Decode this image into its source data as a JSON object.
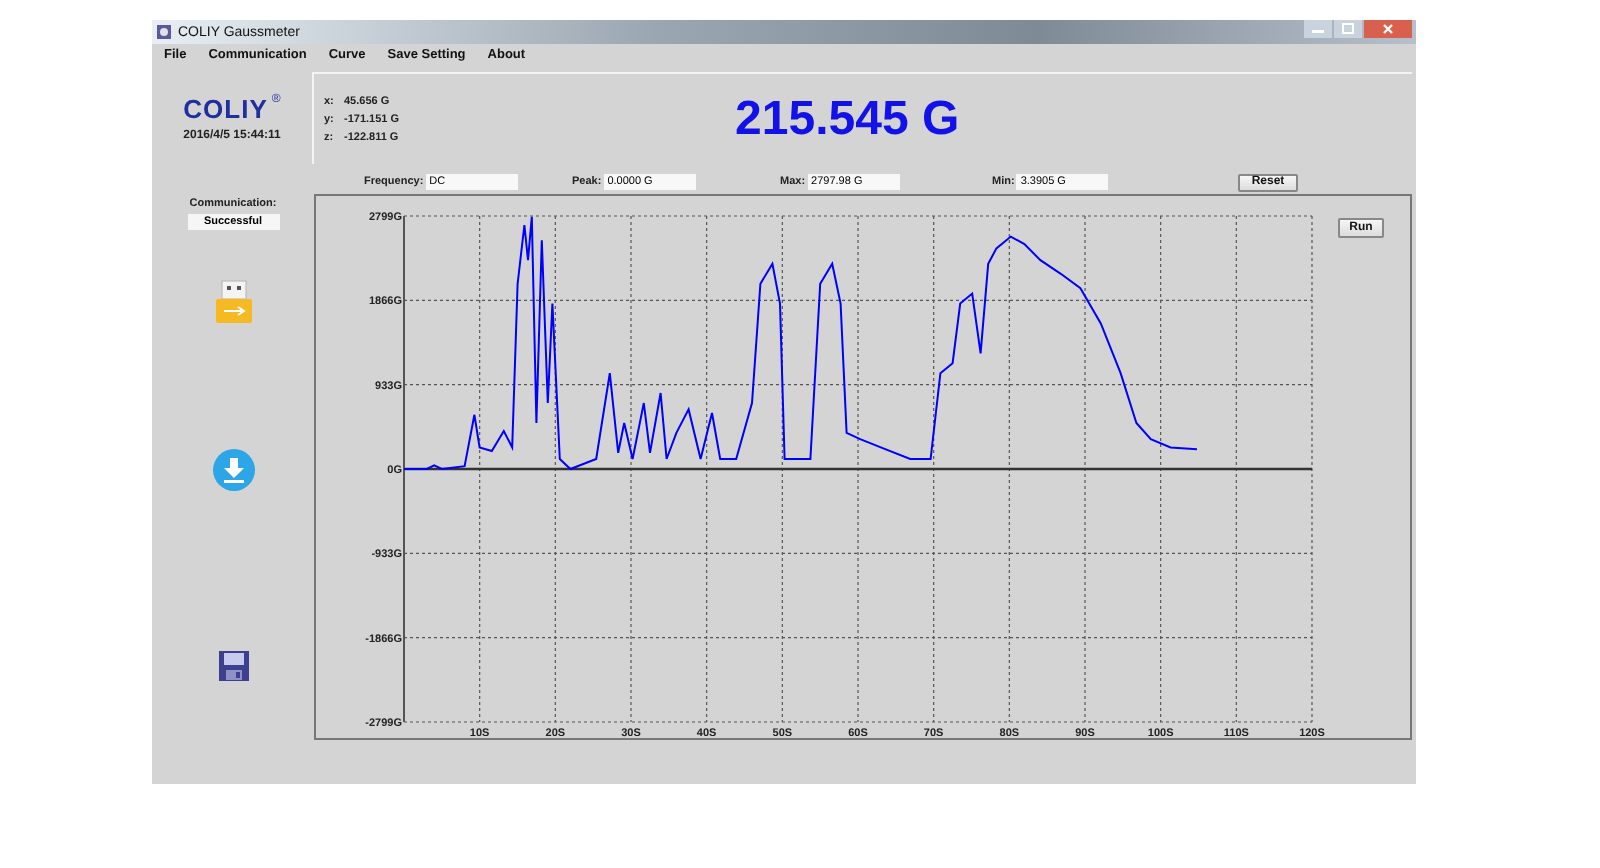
{
  "window": {
    "title": "COLIY Gaussmeter"
  },
  "menu": [
    "File",
    "Communication",
    "Curve",
    "Save Setting",
    "About"
  ],
  "logo": {
    "text": "COLIY",
    "mark": "®"
  },
  "datetime": "2016/4/5 15:44:11",
  "axes": [
    {
      "label": "x:",
      "value": "45.656 G"
    },
    {
      "label": "y:",
      "value": "-171.151 G"
    },
    {
      "label": "z:",
      "value": "-122.811 G"
    }
  ],
  "main_reading": "215.545 G",
  "stats": [
    {
      "label": "Frequency:",
      "value": "DC"
    },
    {
      "label": "Peak:",
      "value": "0.0000 G"
    },
    {
      "label": "Max:",
      "value": "2797.98 G"
    },
    {
      "label": "Min:",
      "value": "3.3905 G"
    }
  ],
  "reset_button": "Reset",
  "sidebar": {
    "communication_label": "Communication:",
    "status": "Successful"
  },
  "chart": {
    "run_button": "Run",
    "chart_data": {
      "type": "line",
      "grid": true,
      "xlim": [
        0,
        120
      ],
      "ylim": [
        -2799,
        2799
      ],
      "xticks": [
        {
          "value": 10,
          "label": "10S"
        },
        {
          "value": 20,
          "label": "20S"
        },
        {
          "value": 30,
          "label": "30S"
        },
        {
          "value": 40,
          "label": "40S"
        },
        {
          "value": 50,
          "label": "50S"
        },
        {
          "value": 60,
          "label": "60S"
        },
        {
          "value": 70,
          "label": "70S"
        },
        {
          "value": 80,
          "label": "80S"
        },
        {
          "value": 90,
          "label": "90S"
        },
        {
          "value": 100,
          "label": "100S"
        },
        {
          "value": 110,
          "label": "110S"
        },
        {
          "value": 120,
          "label": "120S"
        }
      ],
      "yticks": [
        {
          "value": 2799,
          "label": "2799G"
        },
        {
          "value": 1866,
          "label": "1866G"
        },
        {
          "value": 933,
          "label": "933G"
        },
        {
          "value": 0,
          "label": "0G"
        },
        {
          "value": -933,
          "label": "-933G"
        },
        {
          "value": -1866,
          "label": "-1866G"
        },
        {
          "value": -2799,
          "label": "-2799G"
        }
      ],
      "x": [
        0,
        3,
        4,
        5,
        8,
        9.3,
        10,
        11.6,
        13.2,
        14.3,
        15,
        15.9,
        16.4,
        16.9,
        17.5,
        18.2,
        19,
        19.6,
        20.6,
        22,
        25.4,
        27.2,
        28.3,
        29.1,
        30.2,
        31.7,
        32.5,
        33.9,
        34.7,
        36,
        37.6,
        39.2,
        40.7,
        41.8,
        43.9,
        46,
        47.1,
        48.7,
        49.7,
        50.3,
        53.7,
        55,
        56.6,
        57.7,
        58.5,
        60.3,
        63,
        66.9,
        69.6,
        70.9,
        72.5,
        73.5,
        75.1,
        76.2,
        77.2,
        78.3,
        80.2,
        82,
        84.1,
        86.8,
        89.4,
        92.1,
        94.7,
        96.8,
        98.7,
        101.3,
        104.8
      ],
      "series": [
        {
          "color": "#0000ff",
          "values": [
            0,
            0,
            40,
            0,
            30,
            600,
            240,
            200,
            420,
            240,
            2050,
            2700,
            2310,
            2790,
            510,
            2530,
            730,
            1830,
            110,
            0,
            110,
            1060,
            180,
            510,
            110,
            730,
            180,
            840,
            110,
            400,
            660,
            110,
            620,
            110,
            110,
            730,
            2050,
            2270,
            1830,
            110,
            110,
            2050,
            2270,
            1830,
            400,
            330,
            240,
            110,
            110,
            1060,
            1170,
            1830,
            1940,
            1280,
            2270,
            2440,
            2570,
            2490,
            2310,
            2160,
            2000,
            1610,
            1060,
            510,
            330,
            240,
            220
          ]
        }
      ]
    }
  }
}
